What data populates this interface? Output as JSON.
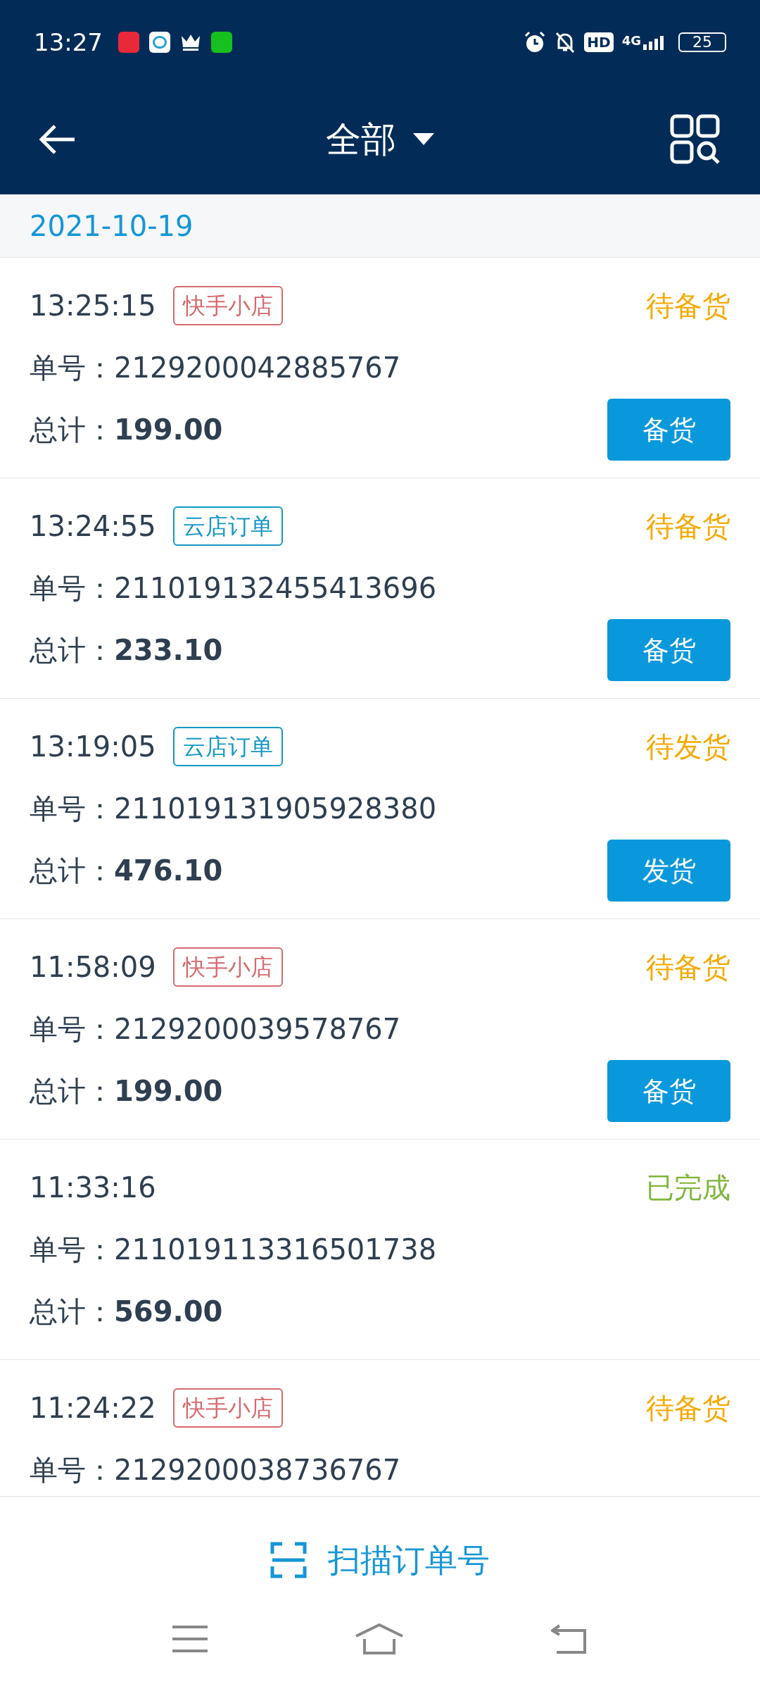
{
  "status_bar": {
    "time": "13:27",
    "hd": "HD",
    "network": "4G",
    "battery": "25"
  },
  "header": {
    "title": "全部"
  },
  "date": "2021-10-19",
  "orders": [
    {
      "time": "13:25:15",
      "tag": {
        "text": "快手小店",
        "color": "#d46a6e"
      },
      "status": {
        "text": "待备货",
        "color": "#f5a900"
      },
      "number_label": "单号：",
      "number": "2129200042885767",
      "total_label": "总计：",
      "total": "199.00",
      "action": "备货"
    },
    {
      "time": "13:24:55",
      "tag": {
        "text": "云店订单",
        "color": "#1597c4"
      },
      "status": {
        "text": "待备货",
        "color": "#f5a900"
      },
      "number_label": "单号：",
      "number": "211019132455413696",
      "total_label": "总计：",
      "total": "233.10",
      "action": "备货"
    },
    {
      "time": "13:19:05",
      "tag": {
        "text": "云店订单",
        "color": "#1597c4"
      },
      "status": {
        "text": "待发货",
        "color": "#f5a900"
      },
      "number_label": "单号：",
      "number": "211019131905928380",
      "total_label": "总计：",
      "total": "476.10",
      "action": "发货"
    },
    {
      "time": "11:58:09",
      "tag": {
        "text": "快手小店",
        "color": "#d46a6e"
      },
      "status": {
        "text": "待备货",
        "color": "#f5a900"
      },
      "number_label": "单号：",
      "number": "2129200039578767",
      "total_label": "总计：",
      "total": "199.00",
      "action": "备货"
    },
    {
      "time": "11:33:16",
      "status": {
        "text": "已完成",
        "color": "#7db53a"
      },
      "number_label": "单号：",
      "number": "211019113316501738",
      "total_label": "总计：",
      "total": "569.00"
    },
    {
      "time": "11:24:22",
      "tag": {
        "text": "快手小店",
        "color": "#d46a6e"
      },
      "status": {
        "text": "待备货",
        "color": "#f5a900"
      },
      "number_label": "单号：",
      "number": "2129200038736767"
    }
  ],
  "scan_button": "扫描订单号"
}
